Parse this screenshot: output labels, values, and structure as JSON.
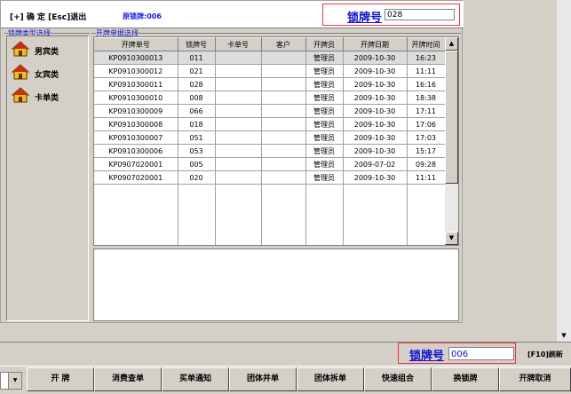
{
  "header": {
    "commands": "[+] 确 定 [Esc]退出",
    "original_lock": "原锁牌:006",
    "lock_label": "锁牌号",
    "lock_value": "028"
  },
  "category_group_label": "锁牌类型选择",
  "categories": [
    {
      "label": "男宾类"
    },
    {
      "label": "女宾类"
    },
    {
      "label": "卡单类"
    }
  ],
  "orders_group_label": "开牌单据选择",
  "table": {
    "columns": [
      "开牌单号",
      "锁牌号",
      "卡单号",
      "客户",
      "开牌员",
      "开牌日期",
      "开牌时间"
    ],
    "rows": [
      [
        "KP0910300013",
        "011",
        "",
        "",
        "管理员",
        "2009-10-30",
        "16:23"
      ],
      [
        "KP0910300012",
        "021",
        "",
        "",
        "管理员",
        "2009-10-30",
        "11:11"
      ],
      [
        "KP0910300011",
        "028",
        "",
        "",
        "管理员",
        "2009-10-30",
        "16:16"
      ],
      [
        "KP0910300010",
        "008",
        "",
        "",
        "管理员",
        "2009-10-30",
        "18:38"
      ],
      [
        "KP0910300009",
        "066",
        "",
        "",
        "管理员",
        "2009-10-30",
        "17:11"
      ],
      [
        "KP0910300008",
        "018",
        "",
        "",
        "管理员",
        "2009-10-30",
        "17:06"
      ],
      [
        "KP0910300007",
        "051",
        "",
        "",
        "管理员",
        "2009-10-30",
        "17:03"
      ],
      [
        "KP0910300006",
        "053",
        "",
        "",
        "管理员",
        "2009-10-30",
        "15:17"
      ],
      [
        "KP0907020001",
        "005",
        "",
        "",
        "管理员",
        "2009-07-02",
        "09:28"
      ],
      [
        "KP0907020001",
        "020",
        "",
        "",
        "管理员",
        "2009-10-30",
        "11:11"
      ]
    ]
  },
  "footer": {
    "lock_label": "锁牌号",
    "lock_value": "006",
    "refresh": "[F10]刷新"
  },
  "buttons": [
    "开 牌",
    "消费查单",
    "买单通知",
    "团体并单",
    "团体拆单",
    "快速组合",
    "换锁牌",
    "开牌取消"
  ],
  "colors": {
    "accent_blue": "#1010cc",
    "highlight_red": "#e23a3a"
  }
}
